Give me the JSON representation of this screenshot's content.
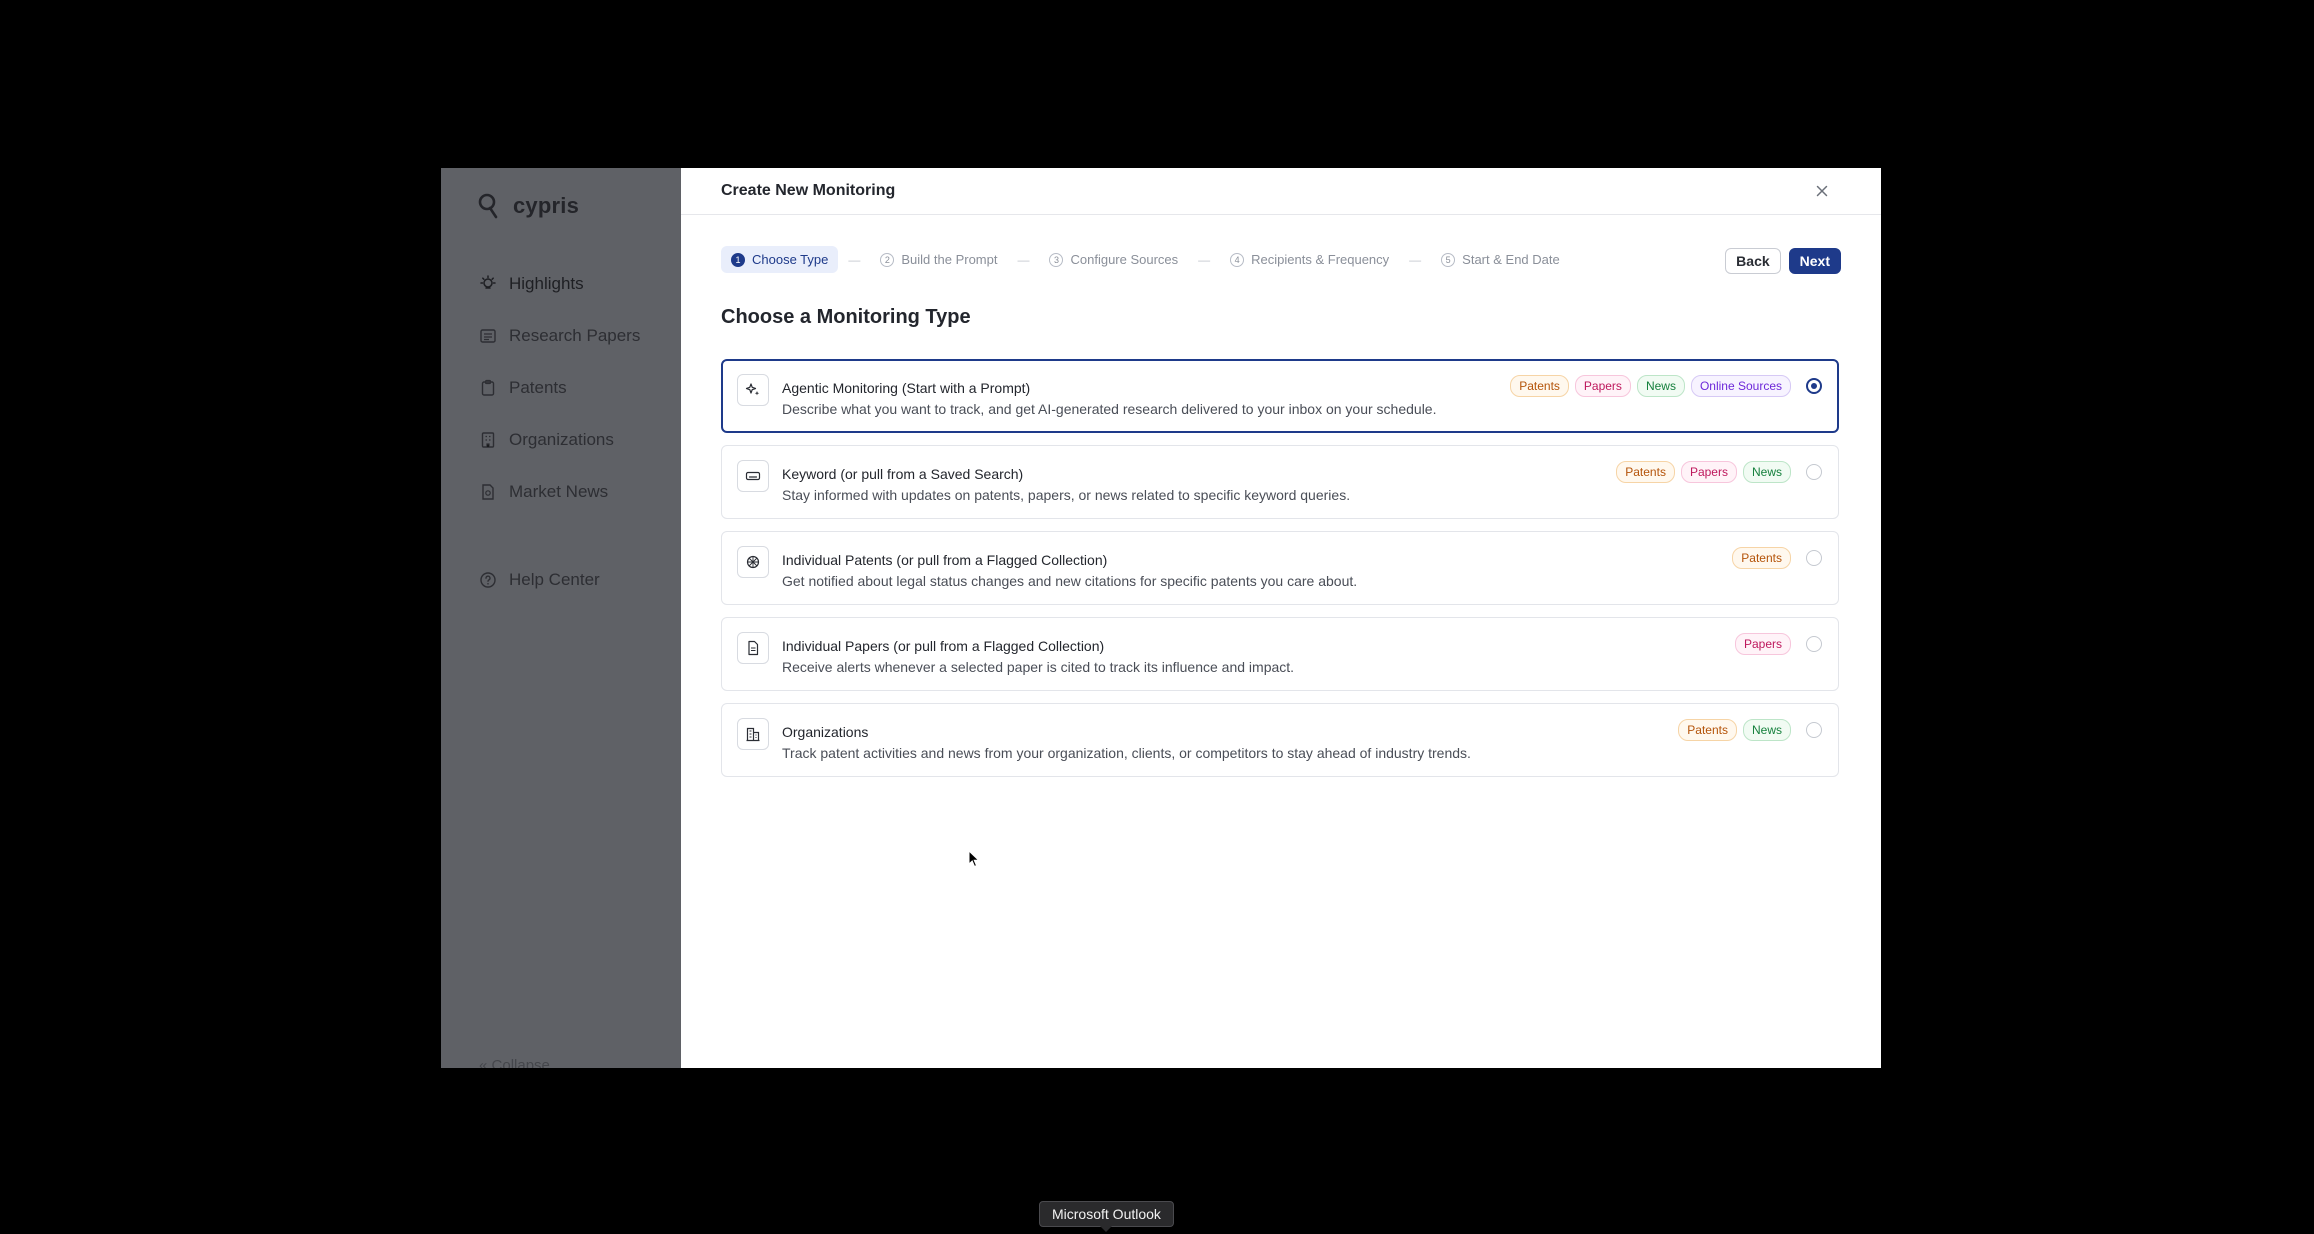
{
  "sidebar": {
    "brand": "cypris",
    "items": [
      {
        "label": "Highlights",
        "icon": "lightbulb-icon"
      },
      {
        "label": "Research Papers",
        "icon": "newspaper-icon"
      },
      {
        "label": "Patents",
        "icon": "clipboard-icon"
      },
      {
        "label": "Organizations",
        "icon": "building-icon"
      },
      {
        "label": "Market News",
        "icon": "news-icon"
      }
    ],
    "help": {
      "label": "Help Center",
      "icon": "help-icon"
    },
    "collapse": "Collapse"
  },
  "modal": {
    "title": "Create New Monitoring",
    "steps": [
      {
        "num": "1",
        "label": "Choose Type"
      },
      {
        "num": "2",
        "label": "Build the Prompt"
      },
      {
        "num": "3",
        "label": "Configure Sources"
      },
      {
        "num": "4",
        "label": "Recipients & Frequency"
      },
      {
        "num": "5",
        "label": "Start & End Date"
      }
    ],
    "step_separator": "—",
    "back_label": "Back",
    "next_label": "Next",
    "section_title": "Choose a Monitoring Type",
    "options": [
      {
        "title": "Agentic Monitoring (Start with a Prompt)",
        "desc": "Describe what you want to track, and get AI-generated research delivered to your inbox on your schedule.",
        "tags": [
          "Patents",
          "Papers",
          "News",
          "Online Sources"
        ],
        "icon": "sparkles-icon",
        "selected": true
      },
      {
        "title": "Keyword (or pull from a Saved Search)",
        "desc": "Stay informed with updates on patents, papers, or news related to specific keyword queries.",
        "tags": [
          "Patents",
          "Papers",
          "News"
        ],
        "icon": "keyboard-icon",
        "selected": false
      },
      {
        "title": "Individual Patents (or pull from a Flagged Collection)",
        "desc": "Get notified about legal status changes and new citations for specific patents you care about.",
        "tags": [
          "Patents"
        ],
        "icon": "patent-icon",
        "selected": false
      },
      {
        "title": "Individual Papers (or pull from a Flagged Collection)",
        "desc": "Receive alerts whenever a selected paper is cited to track its influence and impact.",
        "tags": [
          "Papers"
        ],
        "icon": "document-icon",
        "selected": false
      },
      {
        "title": "Organizations",
        "desc": "Track patent activities and news from your organization, clients, or competitors to stay ahead of industry trends.",
        "tags": [
          "Patents",
          "News"
        ],
        "icon": "building-icon",
        "selected": false
      }
    ]
  },
  "taskbar": {
    "tooltip": "Microsoft Outlook"
  },
  "colors": {
    "accent": "#1e3a8a",
    "overlay_sidebar": "#5f6166",
    "background": "#000000"
  }
}
